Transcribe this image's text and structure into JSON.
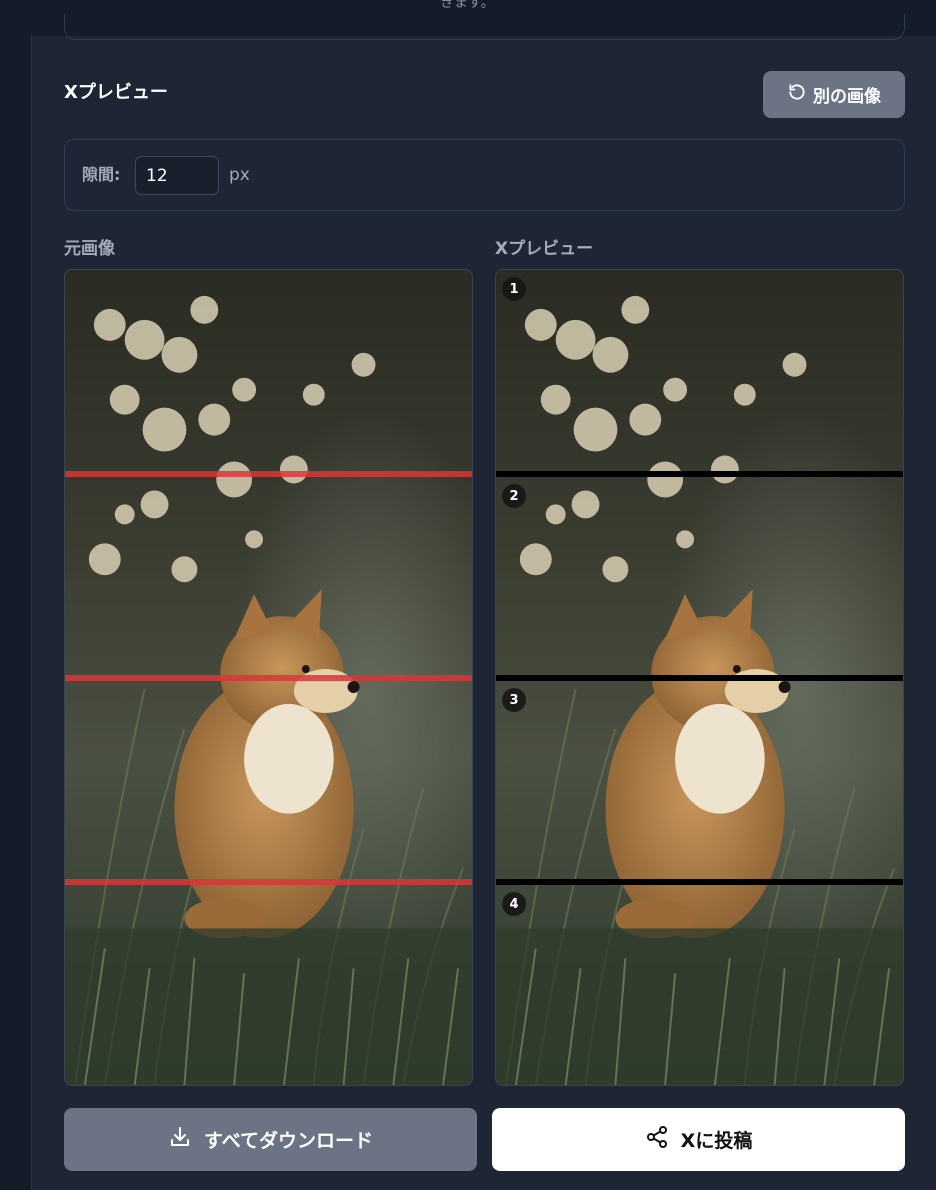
{
  "topbar": {
    "text": "きます。"
  },
  "section": {
    "title": "Xプレビュー",
    "other_image_label": "別の画像"
  },
  "gap": {
    "label": "隙間:",
    "value": "12",
    "unit": "px"
  },
  "original": {
    "label": "元画像"
  },
  "preview": {
    "label": "Xプレビュー",
    "badges": [
      "1",
      "2",
      "3",
      "4"
    ]
  },
  "actions": {
    "download_label": "すべてダウンロード",
    "post_label": "Xに投稿"
  },
  "icons": {
    "refresh": "refresh-icon",
    "download": "download-icon",
    "share": "share-icon"
  },
  "colors": {
    "split_line": "#d73737",
    "preview_gap": "#000000",
    "secondary_button": "#6b7384",
    "background": "#1e2636"
  }
}
